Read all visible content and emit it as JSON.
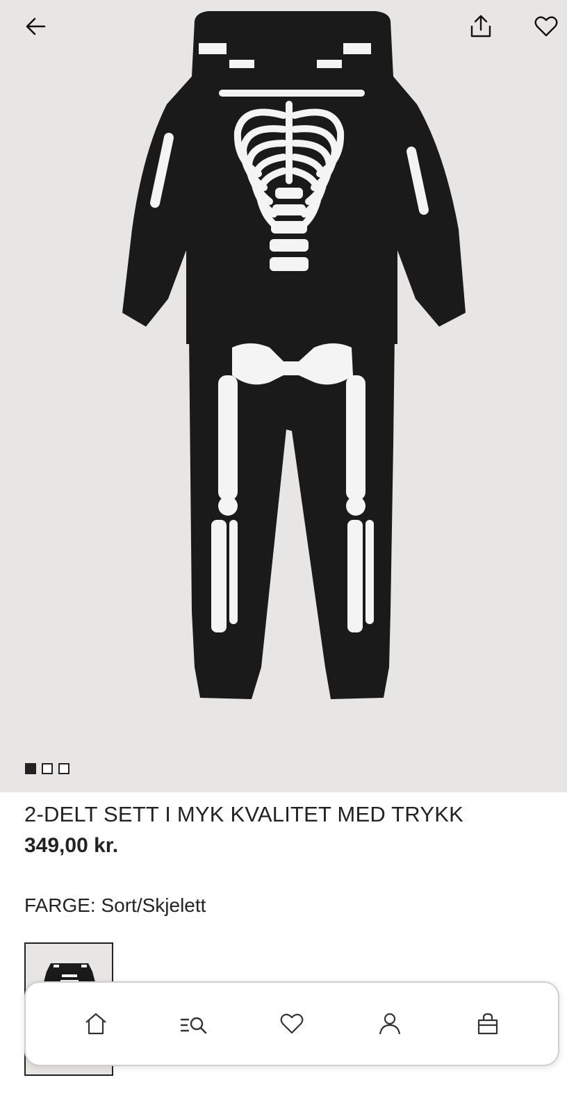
{
  "header": {
    "back_icon": "arrow-left-icon",
    "share_icon": "share-icon",
    "favorite_icon": "heart-icon"
  },
  "gallery": {
    "image_count": 3,
    "active_index": 0
  },
  "product": {
    "title": "2-DELT SETT I MYK KVALITET MED TRYKK",
    "price": "349,00 kr.",
    "color_label": "FARGE:",
    "color_value": "Sort/Skjelett"
  },
  "bottom_nav": {
    "items": [
      {
        "icon": "home-icon"
      },
      {
        "icon": "search-menu-icon"
      },
      {
        "icon": "heart-icon"
      },
      {
        "icon": "user-icon"
      },
      {
        "icon": "shopping-bag-icon"
      }
    ]
  },
  "colors": {
    "background_gray": "#e7e6e5",
    "text": "#222222",
    "garment": "#1a1a1a",
    "print": "#f4f4f4"
  }
}
